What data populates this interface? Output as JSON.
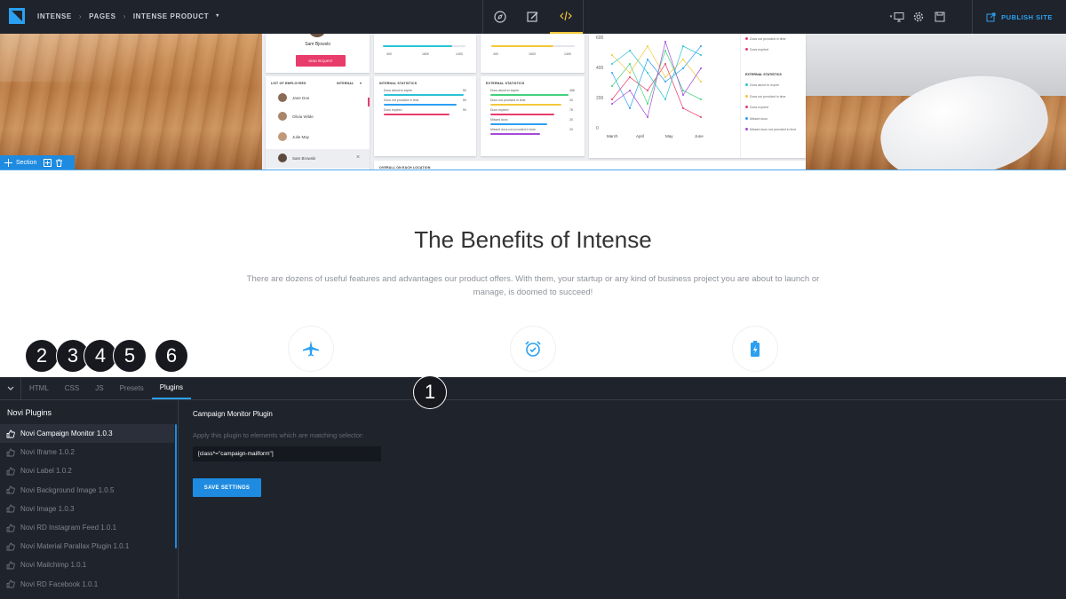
{
  "topbar": {
    "logo_icon": "novi-logo-icon",
    "breadcrumb": [
      "INTENSE",
      "PAGES",
      "INTENSE PRODUCT"
    ],
    "modes": [
      {
        "icon": "compass-icon",
        "active": false
      },
      {
        "icon": "edit-icon",
        "active": false
      },
      {
        "icon": "code-icon",
        "active": true
      }
    ],
    "tools": [
      "desktop-icon",
      "gear-icon",
      "save-icon"
    ],
    "publish_label": "PUBLISH SITE",
    "accent": "#2ba0f1",
    "active_mode_color": "#f3c83a"
  },
  "hero": {
    "section_label": "Section",
    "dashboard": {
      "profile_name": "Sam Bjowski",
      "send_request": "SEND REQUEST",
      "employees_title": "LIST OF EMPLOYEES",
      "employees_filter": "INTERNAL",
      "employees": [
        "Jane Doe",
        "Olivia Wilde",
        "Julie May",
        "Sam Browski"
      ],
      "internal_title": "INTERNAL STATISTICS",
      "internal_rows": [
        {
          "label": "Docs about to expire",
          "value": "50",
          "color": "#2cc3d6"
        },
        {
          "label": "Docs not provided in time",
          "value": "50",
          "color": "#2ba0f1"
        },
        {
          "label": "Docs expired",
          "value": "50",
          "color": "#e83c6b"
        }
      ],
      "external_title": "EXTERNAL STATISTICS",
      "external_rows": [
        {
          "label": "Docs about to expire",
          "value": "456",
          "color": "#44d27e"
        },
        {
          "label": "Docs not provided in time",
          "value": "20",
          "color": "#f3c83a"
        },
        {
          "label": "Docs expired",
          "value": "78",
          "color": "#e83c6b"
        },
        {
          "label": "Missed docs",
          "value": "20",
          "color": "#2ba0f1"
        },
        {
          "label": "Missed docs not provided in time",
          "value": "20",
          "color": "#a44bd8"
        }
      ],
      "overall_title": "OVERALL ON EACH LOCATION",
      "card1_ticks": [
        "400",
        "1600",
        "1400"
      ],
      "card2_ticks": [
        "400",
        "1600",
        "1400"
      ],
      "chart_y_ticks": [
        "600",
        "400",
        "200",
        "0"
      ],
      "chart_x_ticks": [
        "March",
        "April",
        "May",
        "June"
      ],
      "legend_top": [
        "Docs not provided in time",
        "Docs expired"
      ],
      "legend_title": "EXTERNAL STATISTICS",
      "legend_items": [
        {
          "label": "Docs about to expire",
          "color": "#2cc3d6"
        },
        {
          "label": "Docs not provided in time",
          "color": "#f3c83a"
        },
        {
          "label": "Docs expired",
          "color": "#e83c6b"
        },
        {
          "label": "Missed docs",
          "color": "#2ba0f1"
        },
        {
          "label": "Missed docs not provided in time",
          "color": "#a44bd8"
        }
      ]
    }
  },
  "benefits": {
    "title": "The Benefits of Intense",
    "description": "There are dozens of useful features and advantages our product offers. With them, your startup or any kind of business project you are about to launch or manage, is doomed to succeed!",
    "icons": [
      "airplane-icon",
      "alarm-clock-icon",
      "battery-icon"
    ]
  },
  "markers": [
    "1",
    "2",
    "3",
    "4",
    "5",
    "6"
  ],
  "panel": {
    "tabs": [
      {
        "label": "HTML",
        "active": false
      },
      {
        "label": "CSS",
        "active": false
      },
      {
        "label": "JS",
        "active": false
      },
      {
        "label": "Presets",
        "active": false
      },
      {
        "label": "Plugins",
        "active": true
      }
    ],
    "sidebar_title": "Novi Plugins",
    "plugins": [
      {
        "label": "Novi Campaign Monitor 1.0.3",
        "active": true
      },
      {
        "label": "Novi Iframe 1.0.2",
        "active": false
      },
      {
        "label": "Novi Label 1.0.2",
        "active": false
      },
      {
        "label": "Novi Background Image 1.0.5",
        "active": false
      },
      {
        "label": "Novi Image 1.0.3",
        "active": false
      },
      {
        "label": "Novi RD Instagram Feed 1.0.1",
        "active": false
      },
      {
        "label": "Novi Material Parallax Plugin 1.0.1",
        "active": false
      },
      {
        "label": "Novi Mailchimp 1.0.1",
        "active": false
      },
      {
        "label": "Novi RD Facebook 1.0.1",
        "active": false
      }
    ],
    "plugin_title": "Campaign Monitor Plugin",
    "plugin_description": "Apply this plugin to elements which are matching selector:",
    "selector_value": "[class*=\"campaign-mailform\"]",
    "save_label": "SAVE SETTINGS"
  }
}
